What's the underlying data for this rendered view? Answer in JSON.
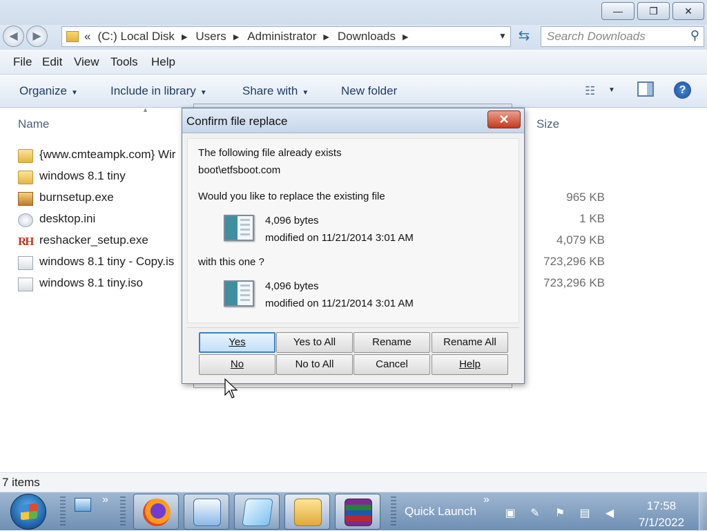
{
  "address": {
    "prefix": "«",
    "crumbs": [
      "(C:) Local Disk",
      "Users",
      "Administrator",
      "Downloads"
    ],
    "search_placeholder": "Search Downloads"
  },
  "window_controls": {
    "minimize": "—",
    "maximize": "❐",
    "close": "✕"
  },
  "menu": [
    "File",
    "Edit",
    "View",
    "Tools",
    "Help"
  ],
  "commands": {
    "organize": "Organize",
    "include": "Include in library",
    "share": "Share with",
    "new_folder": "New folder"
  },
  "columns": {
    "name": "Name",
    "size": "Size"
  },
  "files": [
    {
      "name": "{www.cmteampk.com} Wir",
      "size": "",
      "icon": "folder-icon"
    },
    {
      "name": "windows 8.1 tiny",
      "size": "",
      "icon": "folder-icon"
    },
    {
      "name": "burnsetup.exe",
      "size": "965 KB",
      "icon": "exe-icon"
    },
    {
      "name": "desktop.ini",
      "size": "1 KB",
      "icon": "settings-file-icon"
    },
    {
      "name": "reshacker_setup.exe",
      "size": "4,079 KB",
      "icon": "reshacker-icon"
    },
    {
      "name": "windows 8.1 tiny - Copy.is",
      "size": "723,296 KB",
      "icon": "iso-icon"
    },
    {
      "name": "windows 8.1 tiny.iso",
      "size": "723,296 KB",
      "icon": "iso-icon"
    }
  ],
  "status": {
    "count": "7 items"
  },
  "dialog": {
    "title": "Confirm file replace",
    "close": "✕",
    "line1": "The following file already exists",
    "path": "boot\\etfsboot.com",
    "question": "Would you like to replace the existing file",
    "existing": {
      "size": "4,096 bytes",
      "modified": "modified on 11/21/2014 3:01 AM"
    },
    "with_text": "with this one ?",
    "incoming": {
      "size": "4,096 bytes",
      "modified": "modified on 11/21/2014 3:01 AM"
    },
    "buttons": [
      "Yes",
      "Yes to All",
      "Rename",
      "Rename All",
      "No",
      "No to All",
      "Cancel",
      "Help"
    ]
  },
  "taskbar": {
    "quick_launch": "Quick Launch",
    "chevron": "»",
    "time": "17:58",
    "date": "7/1/2022"
  }
}
